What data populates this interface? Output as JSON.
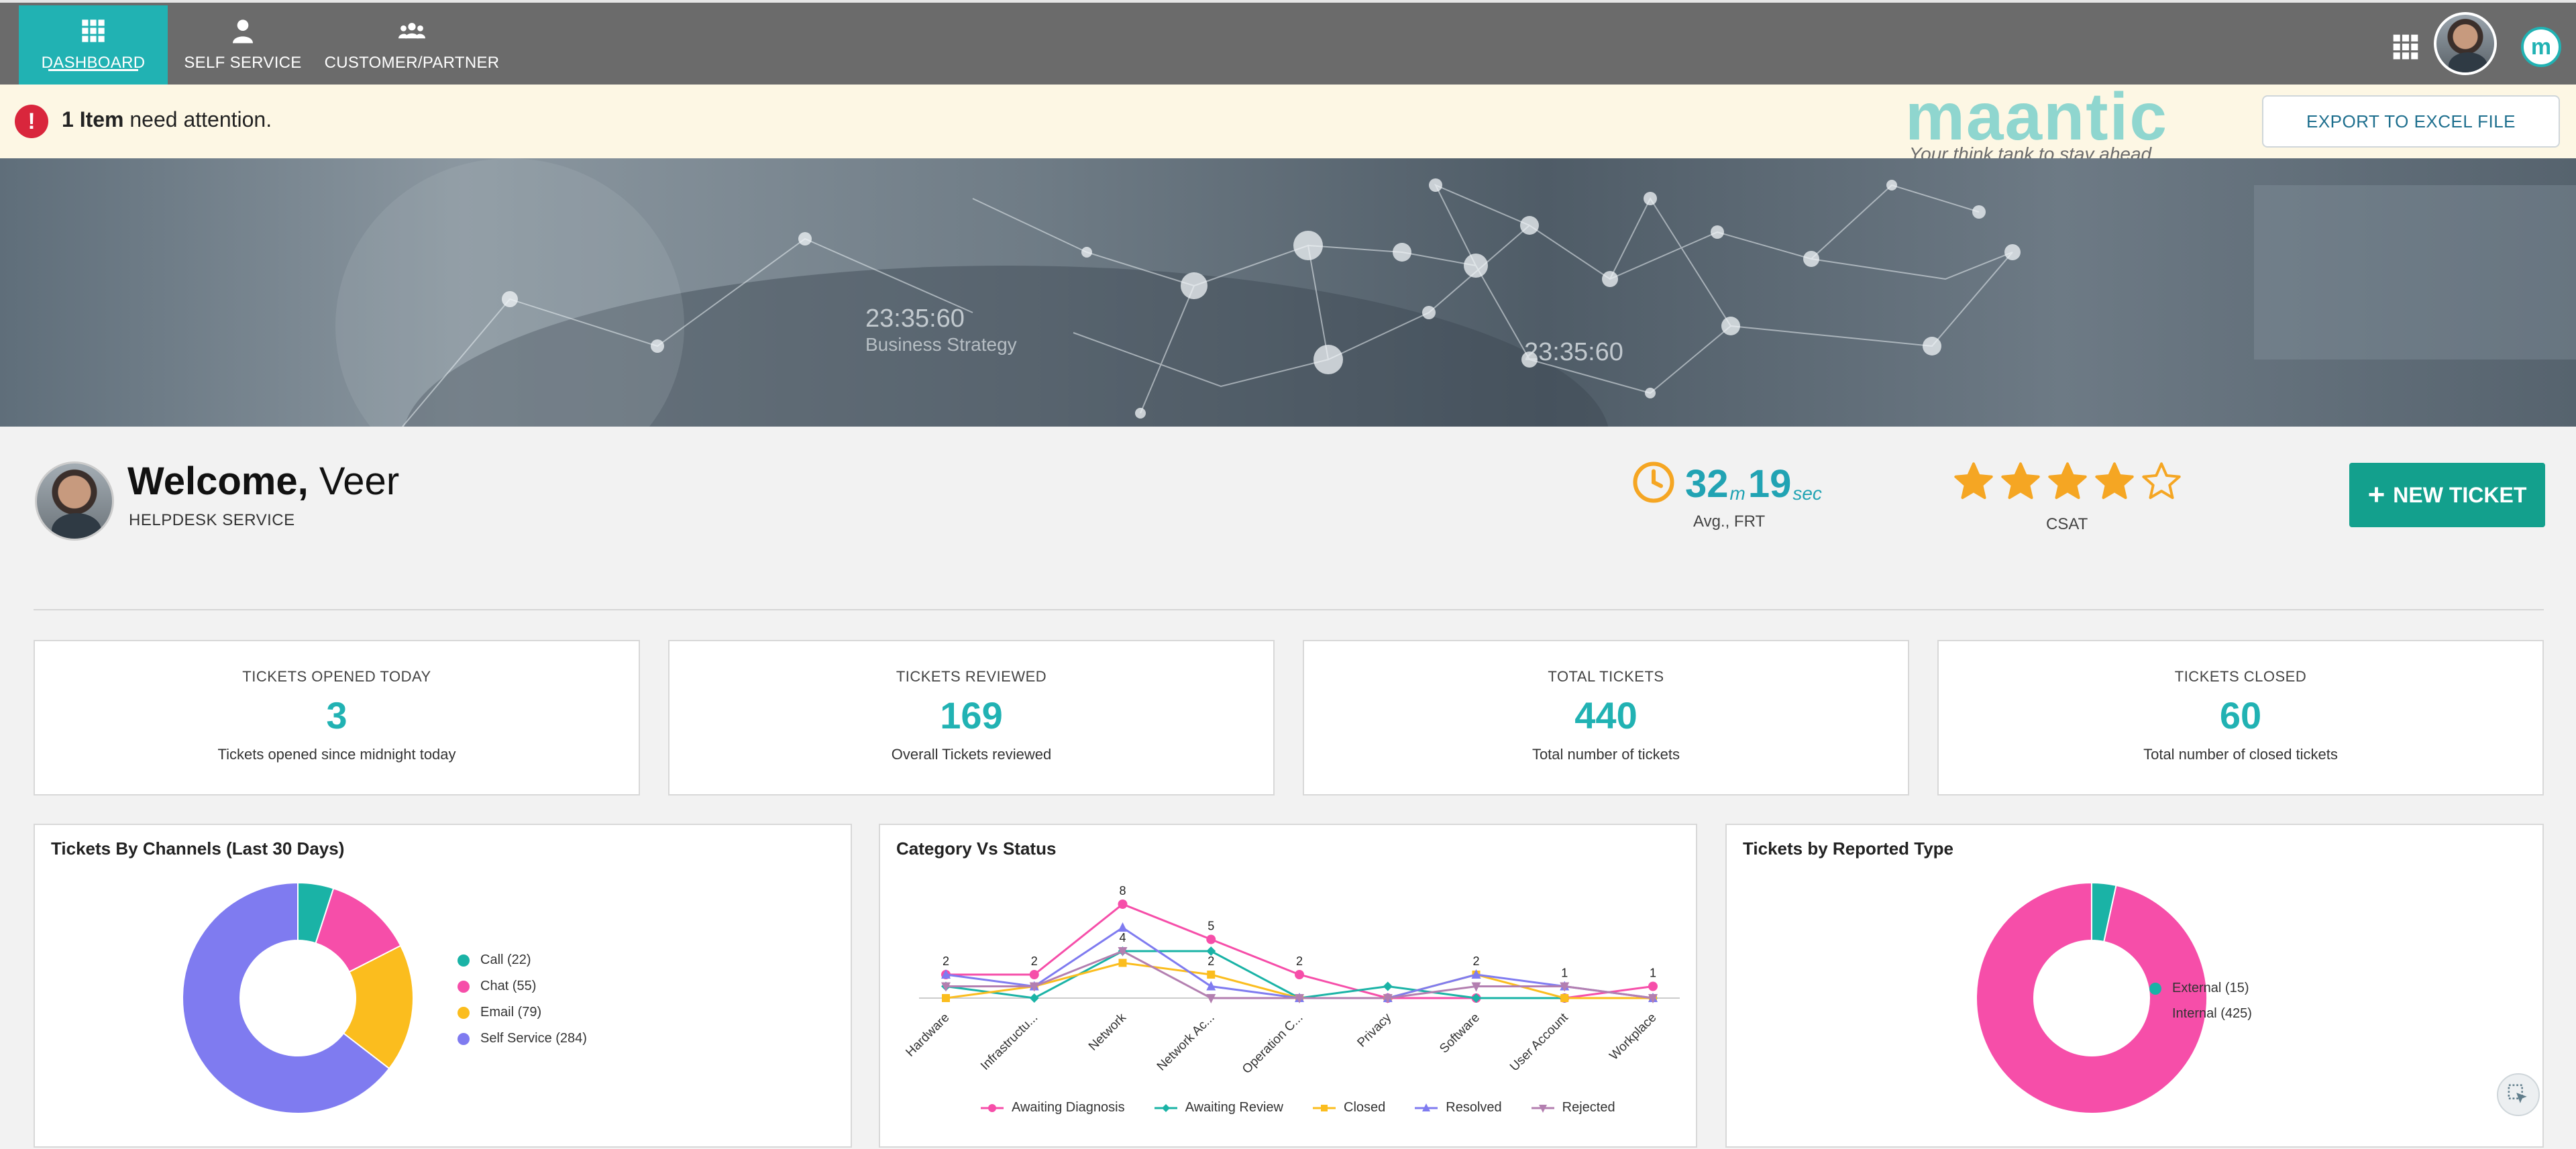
{
  "nav": {
    "items": [
      {
        "label": "DASHBOARD",
        "icon": "grid-icon",
        "active": true
      },
      {
        "label": "SELF SERVICE",
        "icon": "user-icon",
        "active": false
      },
      {
        "label": "CUSTOMER/PARTNER",
        "icon": "users-icon",
        "active": false
      }
    ]
  },
  "attention": {
    "count_text": "1 Item",
    "message": " need attention."
  },
  "brand": {
    "name": "maantic",
    "tagline": "Your think tank to stay ahead"
  },
  "export_label": "EXPORT TO EXCEL FILE",
  "banner": {
    "time_1": "23:35:60",
    "subtitle_1": "Business Strategy",
    "time_2": "23:35:60"
  },
  "welcome": {
    "greeting": "Welcome,",
    "name": " Veer",
    "subtitle": "HELPDESK SERVICE"
  },
  "frt": {
    "minutes": "32",
    "m_unit": "m",
    "seconds": "19",
    "s_unit": "sec",
    "label": "Avg., FRT"
  },
  "csat": {
    "label": "CSAT",
    "rating": 4,
    "max": 5
  },
  "new_ticket_label": "NEW TICKET",
  "stats": [
    {
      "label": "TICKETS OPENED TODAY",
      "value": "3",
      "desc": "Tickets opened since midnight today"
    },
    {
      "label": "TICKETS REVIEWED",
      "value": "169",
      "desc": "Overall Tickets reviewed"
    },
    {
      "label": "TOTAL TICKETS",
      "value": "440",
      "desc": "Total number of tickets"
    },
    {
      "label": "TICKETS CLOSED",
      "value": "60",
      "desc": "Total number of closed tickets"
    }
  ],
  "chart_data": [
    {
      "type": "pie",
      "title": "Tickets By Channels (Last 30 Days)",
      "categories": [
        "Call (22)",
        "Chat (55)",
        "Email (79)",
        "Self Service (284)"
      ],
      "values": [
        22,
        55,
        79,
        284
      ],
      "colors": [
        "#1ab3a6",
        "#f64ea9",
        "#fbbd1e",
        "#7f7bf0"
      ],
      "donut": true,
      "legend": "right"
    },
    {
      "type": "line",
      "title": "Category Vs Status",
      "categories": [
        "Hardware",
        "Infrastructu...",
        "Network",
        "Network Ac...",
        "Operation C...",
        "Privacy",
        "Software",
        "User Account",
        "Workplace"
      ],
      "series": [
        {
          "name": "Awaiting Diagnosis",
          "color": "#f64ea9",
          "marker": "circle",
          "values": [
            2,
            2,
            8,
            5,
            2,
            0,
            0,
            0,
            1
          ]
        },
        {
          "name": "Awaiting Review",
          "color": "#1ab3a6",
          "marker": "diamond",
          "values": [
            1,
            0,
            4,
            4,
            0,
            1,
            0,
            0,
            0
          ]
        },
        {
          "name": "Closed",
          "color": "#fbbd1e",
          "marker": "square",
          "values": [
            0,
            1,
            3,
            2,
            0,
            0,
            2,
            0,
            0
          ]
        },
        {
          "name": "Resolved",
          "color": "#7f7bf0",
          "marker": "triangle",
          "values": [
            2,
            1,
            6,
            1,
            0,
            0,
            2,
            1,
            0
          ]
        },
        {
          "name": "Rejected",
          "color": "#b37fb0",
          "marker": "triangle-down",
          "values": [
            1,
            1,
            4,
            0,
            0,
            0,
            1,
            1,
            0
          ]
        }
      ],
      "data_labels": [
        {
          "category": "Hardware",
          "label": "2"
        },
        {
          "category": "Infrastructu...",
          "label": "2"
        },
        {
          "category": "Network",
          "label": "8"
        },
        {
          "category": "Network",
          "label": "4"
        },
        {
          "category": "Network Ac...",
          "label": "5"
        },
        {
          "category": "Network Ac...",
          "label": "2"
        },
        {
          "category": "Operation C...",
          "label": "2"
        },
        {
          "category": "Software",
          "label": "2"
        },
        {
          "category": "User Account",
          "label": "1"
        },
        {
          "category": "Workplace",
          "label": "1"
        }
      ],
      "ylim": [
        0,
        8
      ],
      "legend": "bottom"
    },
    {
      "type": "pie",
      "title": "Tickets by Reported Type",
      "categories": [
        "External (15)",
        "Internal (425)"
      ],
      "values": [
        15,
        425
      ],
      "colors": [
        "#1ab3a6",
        "#f64ea9"
      ],
      "donut": true,
      "legend": "right"
    }
  ]
}
